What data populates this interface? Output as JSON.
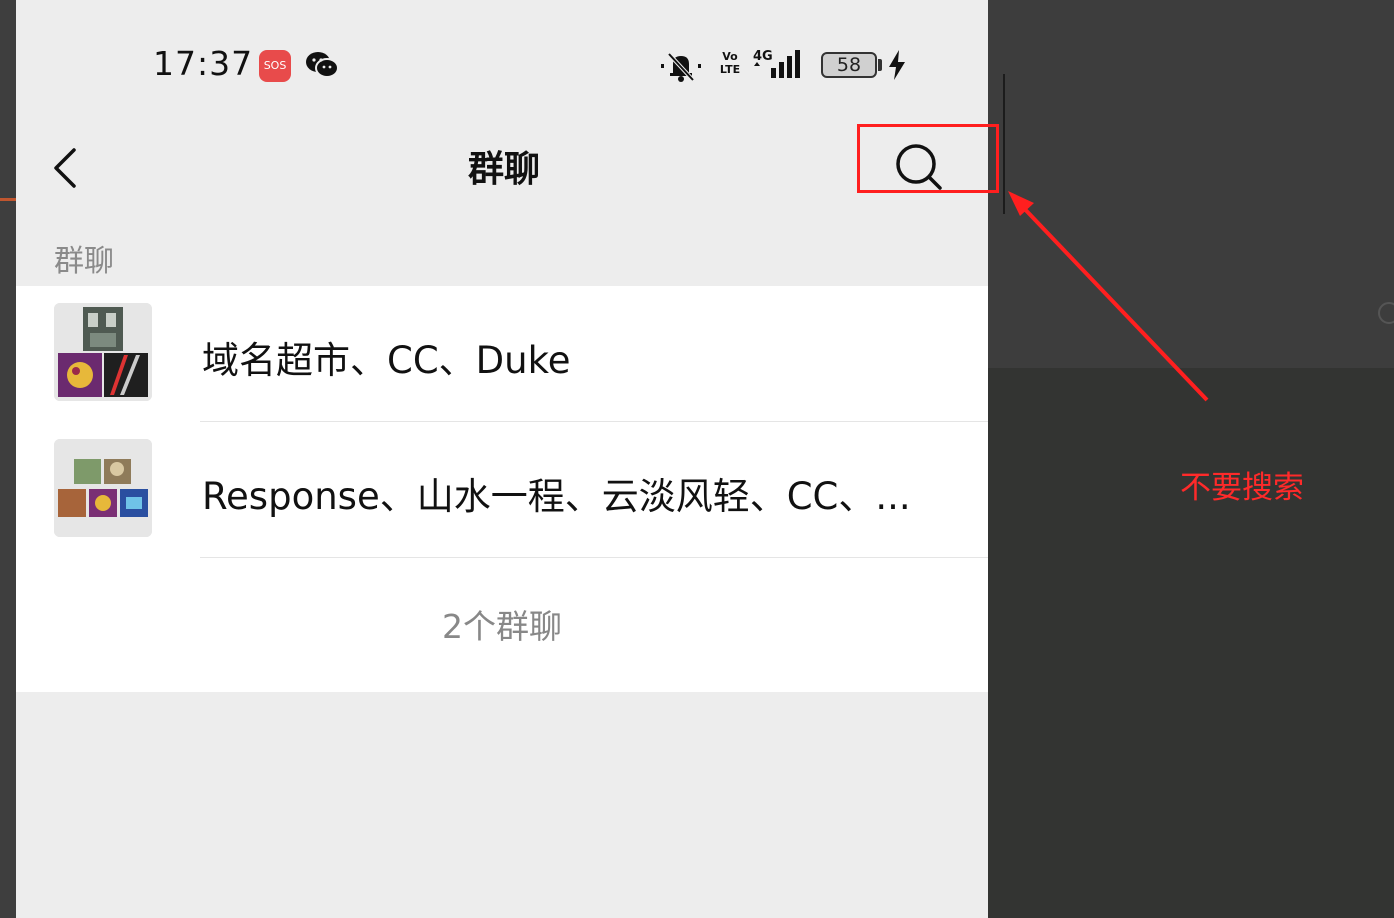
{
  "status_bar": {
    "time": "17:37",
    "sos": "SOS",
    "volte": "Vo LTE",
    "network": "4G",
    "battery": "58"
  },
  "nav": {
    "title": "群聊"
  },
  "section_header": "群聊",
  "groups": [
    {
      "name": "域名超市、CC、Duke",
      "avatar_icon": "group-avatar-grid"
    },
    {
      "name": "Response、山水一程、云淡风轻、CC、...",
      "avatar_icon": "group-avatar-grid"
    }
  ],
  "footer": {
    "count_label": "2个群聊"
  },
  "annotation": {
    "text": "不要搜索",
    "color": "#ff2a2a"
  }
}
